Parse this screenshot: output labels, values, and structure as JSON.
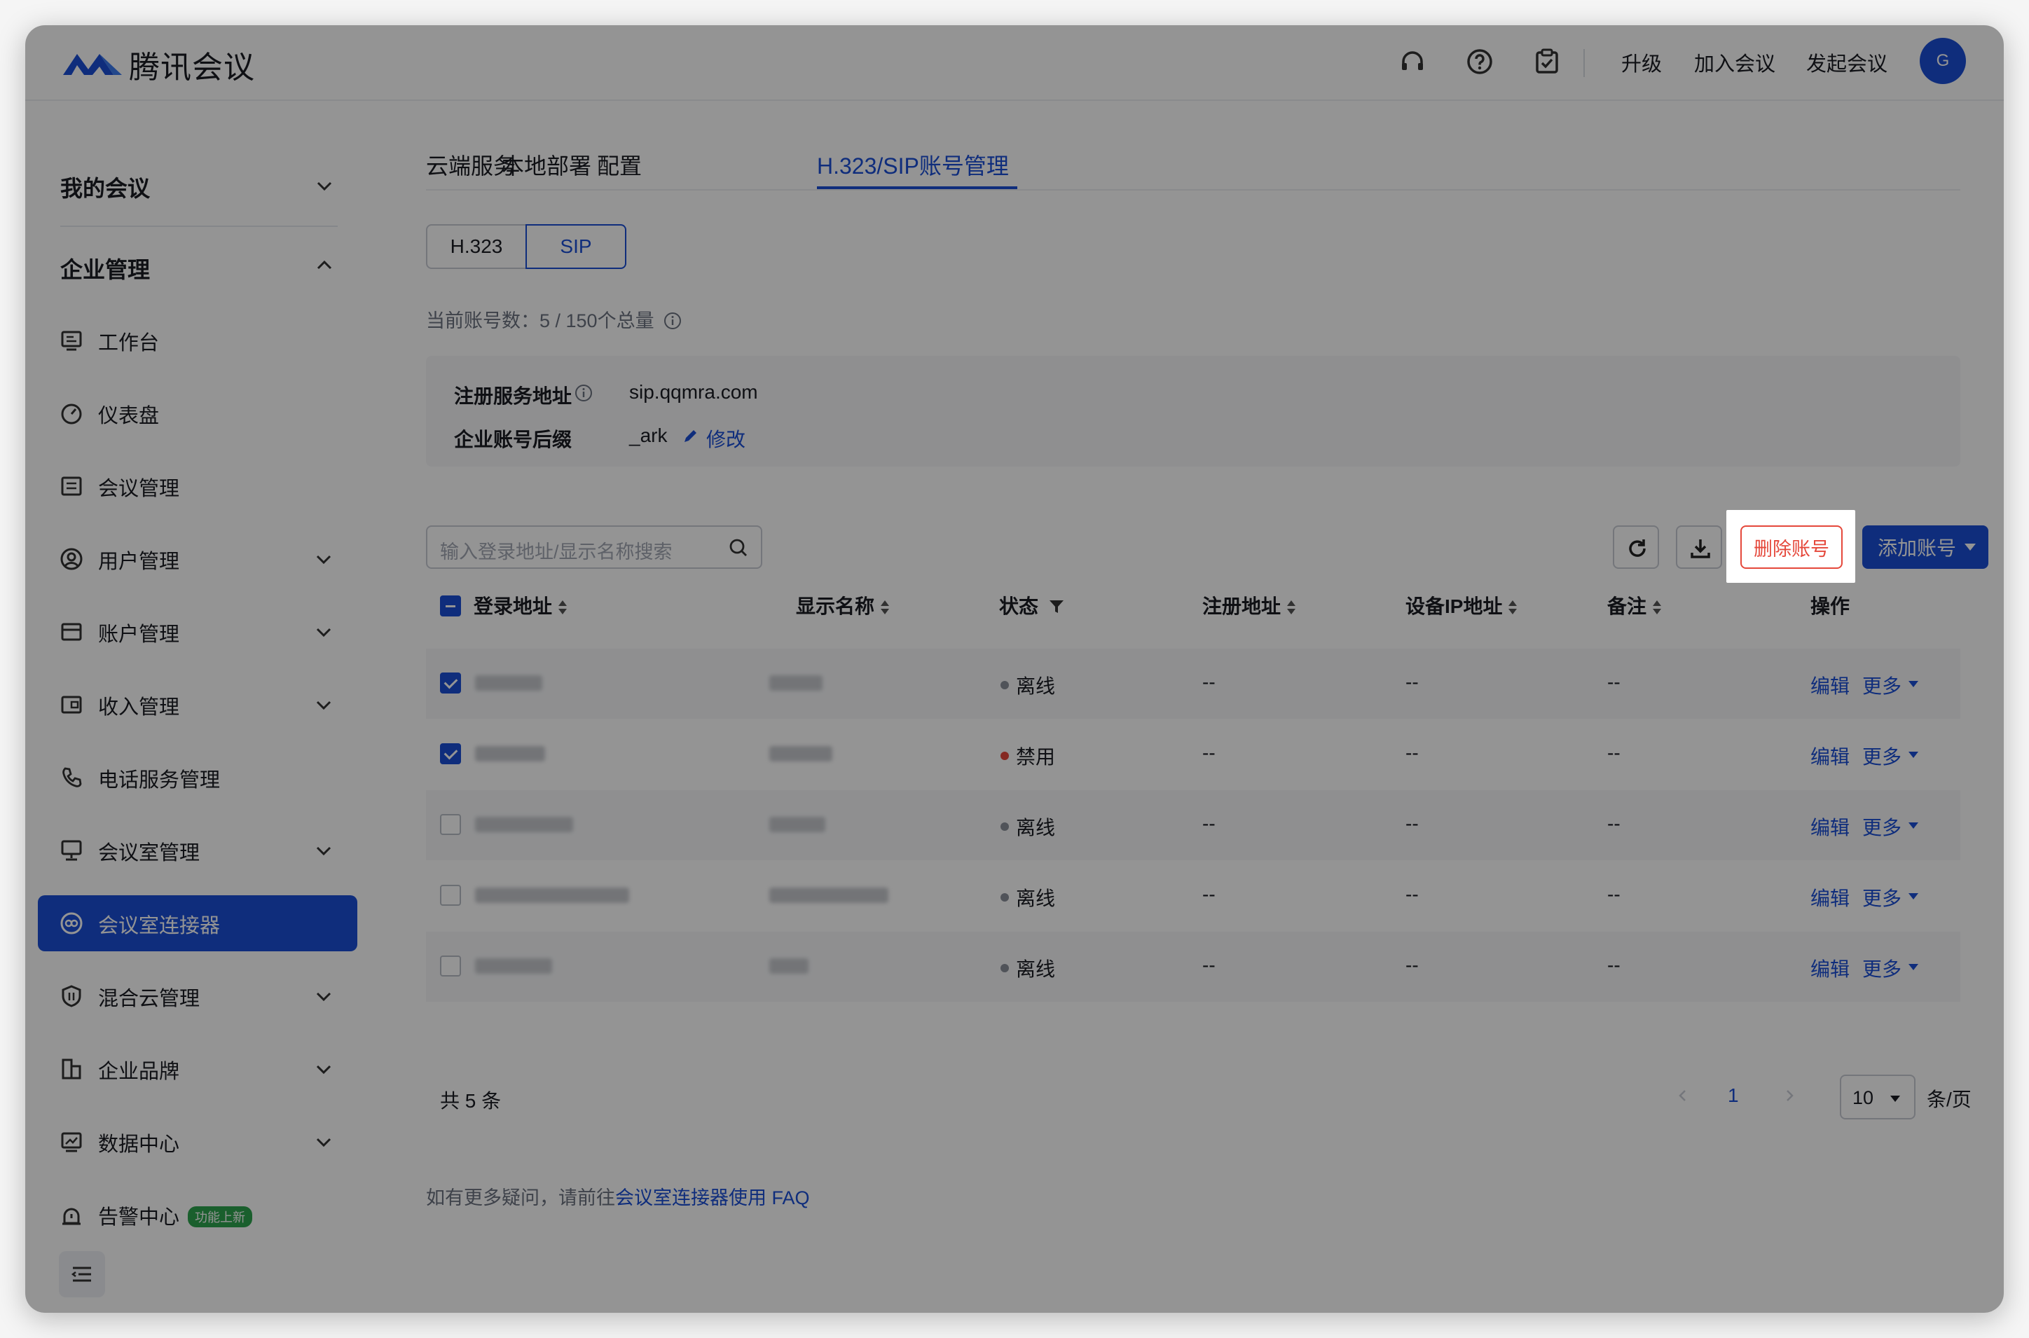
{
  "app": {
    "brand": "腾讯会议"
  },
  "header": {
    "links": [
      "升级",
      "加入会议",
      "发起会议"
    ],
    "avatar": "G",
    "icons": [
      "headset-icon",
      "help-icon",
      "clipboard-check-icon"
    ]
  },
  "sidebar": {
    "sections": [
      "我的会议",
      "企业管理"
    ],
    "items": [
      {
        "label": "工作台",
        "icon": "desktop-icon",
        "expandable": false
      },
      {
        "label": "仪表盘",
        "icon": "gauge-icon",
        "expandable": false
      },
      {
        "label": "会议管理",
        "icon": "list-icon",
        "expandable": false
      },
      {
        "label": "用户管理",
        "icon": "user-icon",
        "expandable": true
      },
      {
        "label": "账户管理",
        "icon": "wallet-icon",
        "expandable": true
      },
      {
        "label": "收入管理",
        "icon": "income-icon",
        "expandable": true
      },
      {
        "label": "电话服务管理",
        "icon": "phone-icon",
        "expandable": false
      },
      {
        "label": "会议室管理",
        "icon": "meeting-room-icon",
        "expandable": true
      },
      {
        "label": "会议室连接器",
        "icon": "link-icon",
        "expandable": false,
        "active": true
      },
      {
        "label": "混合云管理",
        "icon": "shield-icon",
        "expandable": true
      },
      {
        "label": "企业品牌",
        "icon": "building-icon",
        "expandable": true
      },
      {
        "label": "数据中心",
        "icon": "chart-icon",
        "expandable": true
      },
      {
        "label": "告警中心",
        "icon": "alarm-icon",
        "expandable": false,
        "badge": "功能上新"
      }
    ]
  },
  "tabs": [
    "云端服务",
    "本地部署",
    "配置",
    "H.323/SIP账号管理"
  ],
  "segments": [
    "H.323",
    "SIP"
  ],
  "quota": "当前账号数：5 / 150个总量",
  "info": {
    "reg_label": "注册服务地址",
    "reg_value": "sip.qqmra.com",
    "suffix_label": "企业账号后缀",
    "suffix_value": "_ark",
    "edit_link": "修改"
  },
  "toolbar": {
    "search_placeholder": "输入登录地址/显示名称搜索",
    "delete_label": "删除账号",
    "add_label": "添加账号"
  },
  "table": {
    "columns": [
      "登录地址",
      "显示名称",
      "状态",
      "注册地址",
      "设备IP地址",
      "备注",
      "操作"
    ],
    "rows": [
      {
        "checked": true,
        "status": "离线",
        "status_color": "#8a8f99",
        "reg": "--",
        "ip": "--",
        "note": "--"
      },
      {
        "checked": true,
        "status": "禁用",
        "status_color": "#e5483b",
        "reg": "--",
        "ip": "--",
        "note": "--"
      },
      {
        "checked": false,
        "status": "离线",
        "status_color": "#8a8f99",
        "reg": "--",
        "ip": "--",
        "note": "--"
      },
      {
        "checked": false,
        "status": "离线",
        "status_color": "#8a8f99",
        "reg": "--",
        "ip": "--",
        "note": "--"
      },
      {
        "checked": false,
        "status": "离线",
        "status_color": "#8a8f99",
        "reg": "--",
        "ip": "--",
        "note": "--"
      }
    ],
    "edit_label": "编辑",
    "more_label": "更多"
  },
  "pagination": {
    "total": "共 5 条",
    "page": "1",
    "page_size": "10",
    "per_page": "条/页"
  },
  "faq": {
    "prefix": "如有更多疑问，请前往",
    "link": "会议室连接器使用 FAQ"
  },
  "colors": {
    "accent": "#1a4fd6",
    "danger": "#e5483b"
  }
}
